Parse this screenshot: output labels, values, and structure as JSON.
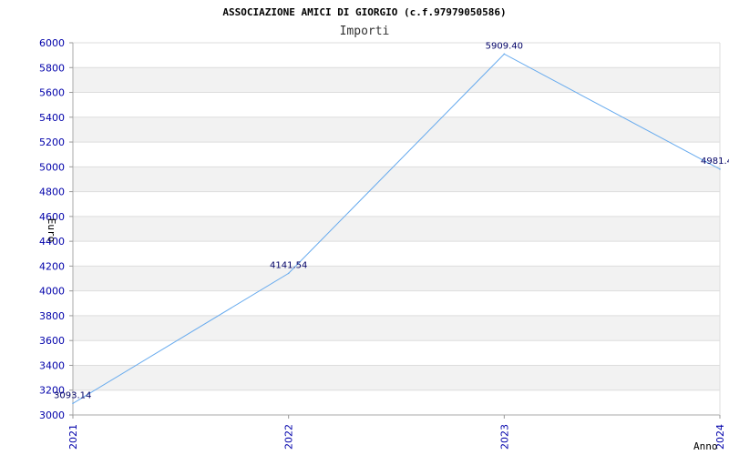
{
  "chart_data": {
    "type": "line",
    "title": "ASSOCIAZIONE AMICI DI GIORGIO (c.f.97979050586)",
    "subtitle": "Importi",
    "xlabel": "Anno",
    "ylabel": "Euro",
    "categories": [
      "2021",
      "2022",
      "2023",
      "2024"
    ],
    "series": [
      {
        "values": [
          3093.14,
          4141.54,
          5909.4,
          4981.4
        ],
        "labels": [
          "3093.14",
          "4141.54",
          "5909.40",
          "4981.4"
        ],
        "color": "#66aaee"
      }
    ],
    "ylim": [
      3000,
      6000
    ],
    "yticks": [
      "3000",
      "3200",
      "3400",
      "3600",
      "3800",
      "4000",
      "4200",
      "4400",
      "4600",
      "4800",
      "5000",
      "5200",
      "5400",
      "5600",
      "5800",
      "6000"
    ],
    "grid": true,
    "band_color": "#f2f2f2",
    "tick_color": "#0000aa",
    "legend": "none"
  }
}
